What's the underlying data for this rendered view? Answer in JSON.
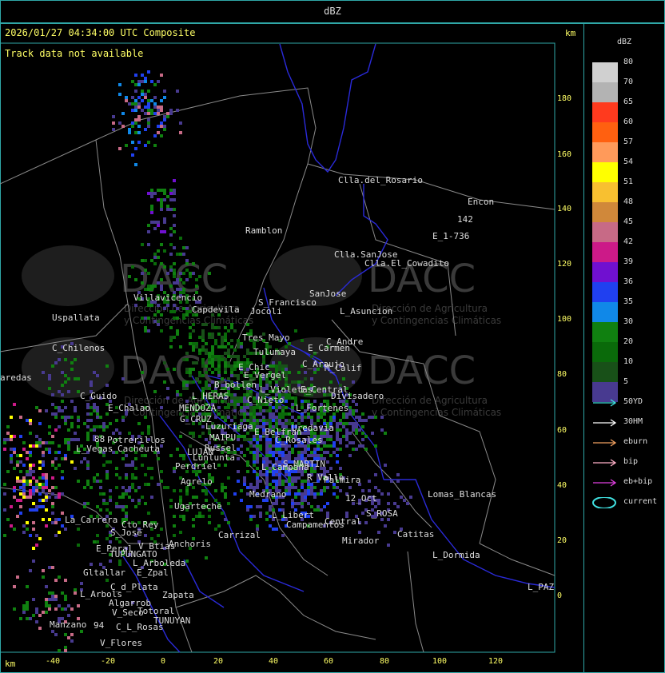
{
  "header": {
    "title": "dBZ"
  },
  "map": {
    "timestamp": "2026/01/27 04:34:00 UTC Composite",
    "track_notice": "Track data not available",
    "axis_unit": "km",
    "y_ticks": [
      "180",
      "160",
      "140",
      "120",
      "100",
      "80",
      "60",
      "40",
      "20",
      "0"
    ],
    "x_ticks": [
      "-40",
      "-20",
      "0",
      "20",
      "40",
      "60",
      "80",
      "100",
      "120"
    ],
    "watermark": {
      "brand": "DACC",
      "line1": "Dirección de Agricultura",
      "line2": "y Contingencias Climáticas"
    },
    "places": [
      {
        "name": "Clla.del_Rosario"
      },
      {
        "name": "Encon"
      },
      {
        "name": "142"
      },
      {
        "name": "E_1-736"
      },
      {
        "name": "Ramblon"
      },
      {
        "name": "Clla.SanJose"
      },
      {
        "name": "Clla.El_Cowadito"
      },
      {
        "name": "SanJose"
      },
      {
        "name": "S_Francisco"
      },
      {
        "name": "L_Asuncion"
      },
      {
        "name": "Capdevila"
      },
      {
        "name": "Jocoli"
      },
      {
        "name": "Villavicencio"
      },
      {
        "name": "Uspallata"
      },
      {
        "name": "C_Chilenos"
      },
      {
        "name": "Tres_Mayo"
      },
      {
        "name": "Tulumaya"
      },
      {
        "name": "C_Andre"
      },
      {
        "name": "E_Carmen"
      },
      {
        "name": "C_Araujo"
      },
      {
        "name": "M_Calif"
      },
      {
        "name": "E_Chic"
      },
      {
        "name": "E_Vergel"
      },
      {
        "name": "aredas"
      },
      {
        "name": "B_bollen"
      },
      {
        "name": "L_Violetas"
      },
      {
        "name": "E_Central"
      },
      {
        "name": "Divisadero"
      },
      {
        "name": "C_Guido"
      },
      {
        "name": "E_Chalao"
      },
      {
        "name": "L_HERAS"
      },
      {
        "name": "C_Nieto"
      },
      {
        "name": "L_Fortenes"
      },
      {
        "name": "MENDOZA"
      },
      {
        "name": "G_CRUZ"
      },
      {
        "name": "Luzuriaga"
      },
      {
        "name": "E_Belfran"
      },
      {
        "name": "Uredavia"
      },
      {
        "name": "88"
      },
      {
        "name": "Potrerillos"
      },
      {
        "name": "MAIPU"
      },
      {
        "name": "Russel"
      },
      {
        "name": "C_Rosales"
      },
      {
        "name": "L_Vegas"
      },
      {
        "name": "Cacheuta"
      },
      {
        "name": "LUJAN"
      },
      {
        "name": "Lunlunta"
      },
      {
        "name": "Perdriel"
      },
      {
        "name": "L_Campana"
      },
      {
        "name": "S_MARTIN"
      },
      {
        "name": "Agrelo"
      },
      {
        "name": "R_Valle"
      },
      {
        "name": "Palmira"
      },
      {
        "name": "Medrano"
      },
      {
        "name": "Ugarteche"
      },
      {
        "name": "12_Oct"
      },
      {
        "name": "Lomas_Blancas"
      },
      {
        "name": "S_ROSA"
      },
      {
        "name": "L_Libert"
      },
      {
        "name": "Central"
      },
      {
        "name": "Campamentos"
      },
      {
        "name": "La_Carrera"
      },
      {
        "name": "Cto_Rey"
      },
      {
        "name": "S_Jose"
      },
      {
        "name": "Catitas"
      },
      {
        "name": "Carrizal"
      },
      {
        "name": "Mirador"
      },
      {
        "name": "E_Peral"
      },
      {
        "name": "V_Btias"
      },
      {
        "name": "Anchoris"
      },
      {
        "name": "TUPUNGATO"
      },
      {
        "name": "L_Dormida"
      },
      {
        "name": "L_Arboleda"
      },
      {
        "name": "Gltallar"
      },
      {
        "name": "E_Zpal"
      },
      {
        "name": "C_d_Plata"
      },
      {
        "name": "L_Arbols"
      },
      {
        "name": "Zapata"
      },
      {
        "name": "L_PAZ"
      },
      {
        "name": "Algarrob"
      },
      {
        "name": "V_Seco"
      },
      {
        "name": "Totoral"
      },
      {
        "name": "TUNUYAN"
      },
      {
        "name": "Manzano"
      },
      {
        "name": "C_L_Rosas"
      },
      {
        "name": "94"
      },
      {
        "name": "V_Flores"
      }
    ]
  },
  "legend": {
    "title": "dBZ",
    "bins": [
      {
        "label": "80",
        "color": "#d0d0d0"
      },
      {
        "label": "70",
        "color": "#b3b3b3"
      },
      {
        "label": "65",
        "color": "#ff3a1e"
      },
      {
        "label": "60",
        "color": "#ff6010"
      },
      {
        "label": "57",
        "color": "#ff9a5a"
      },
      {
        "label": "54",
        "color": "#ffff00"
      },
      {
        "label": "51",
        "color": "#f8c030"
      },
      {
        "label": "48",
        "color": "#d0883a"
      },
      {
        "label": "45",
        "color": "#c76a86"
      },
      {
        "label": "42",
        "color": "#cc1a88"
      },
      {
        "label": "39",
        "color": "#7010d0"
      },
      {
        "label": "36",
        "color": "#2040f0"
      },
      {
        "label": "35",
        "color": "#1088e8"
      },
      {
        "label": "30",
        "color": "#108010"
      },
      {
        "label": "20",
        "color": "#0a6a0a"
      },
      {
        "label": "10",
        "color": "#185018"
      },
      {
        "label": "5",
        "color": "#483a90"
      }
    ],
    "tracks": [
      {
        "label": "50YD",
        "color": "#40e0e0"
      },
      {
        "label": "30HM",
        "color": "#ffffff"
      },
      {
        "label": "eburn",
        "color": "#f0a060"
      },
      {
        "label": "bip",
        "color": "#ffb0c8"
      },
      {
        "label": "eb+bip",
        "color": "#e040e0"
      },
      {
        "label": "current",
        "color": "#40e0e0"
      }
    ]
  }
}
